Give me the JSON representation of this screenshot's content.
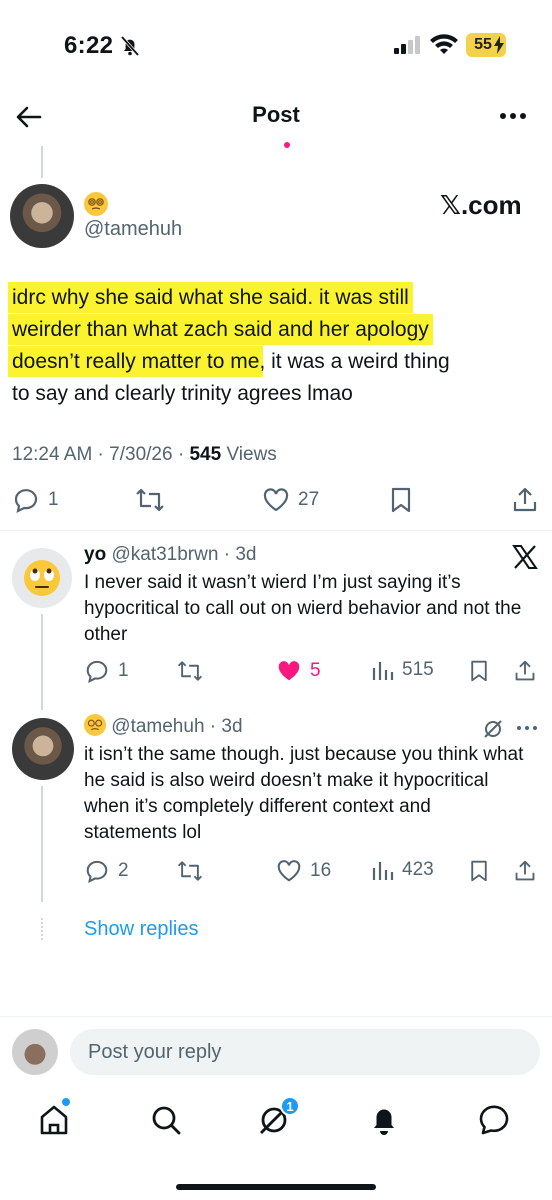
{
  "status_bar": {
    "time": "6:22",
    "battery": "55"
  },
  "header": {
    "title": "Post"
  },
  "main_post": {
    "emoji": "😵‍💫",
    "handle": "@tamehuh",
    "source_logo": "𝕏.com",
    "text_highlighted_1": "idrc why she said what she said. it was still",
    "text_highlighted_2": "weirder than what zach said and her apology",
    "text_highlighted_3": "doesn’t really matter to me",
    "text_rest_3": ", it was a weird thing",
    "text_line_4": "to say and clearly trinity agrees lmao",
    "time": "12:24 AM",
    "date": "7/30/26",
    "views_count": "545",
    "views_label": "Views",
    "replies": "1",
    "likes": "27"
  },
  "replies": [
    {
      "name": "yo",
      "handle": "@kat31brwn",
      "age": "3d",
      "avatar_emoji": "🙄",
      "text": "I never said it wasn’t wierd I’m just saying it’s hypocritical to call out on wierd behavior and not the other",
      "replies": "1",
      "likes": "5",
      "views": "515"
    },
    {
      "emoji": "😵‍💫",
      "handle": "@tamehuh",
      "age": "3d",
      "text": "it isn’t the same though. just because you think what he said is also weird doesn’t make it hypocritical when it’s completely different context and statements lol",
      "replies": "2",
      "likes": "16",
      "views": "423"
    }
  ],
  "show_replies": "Show replies",
  "composer": {
    "placeholder": "Post your reply"
  },
  "nav": {
    "messages_badge": "1"
  },
  "colors": {
    "accent": "#1d9bf0",
    "highlight": "#fbf330",
    "like_active": "#f91880"
  }
}
